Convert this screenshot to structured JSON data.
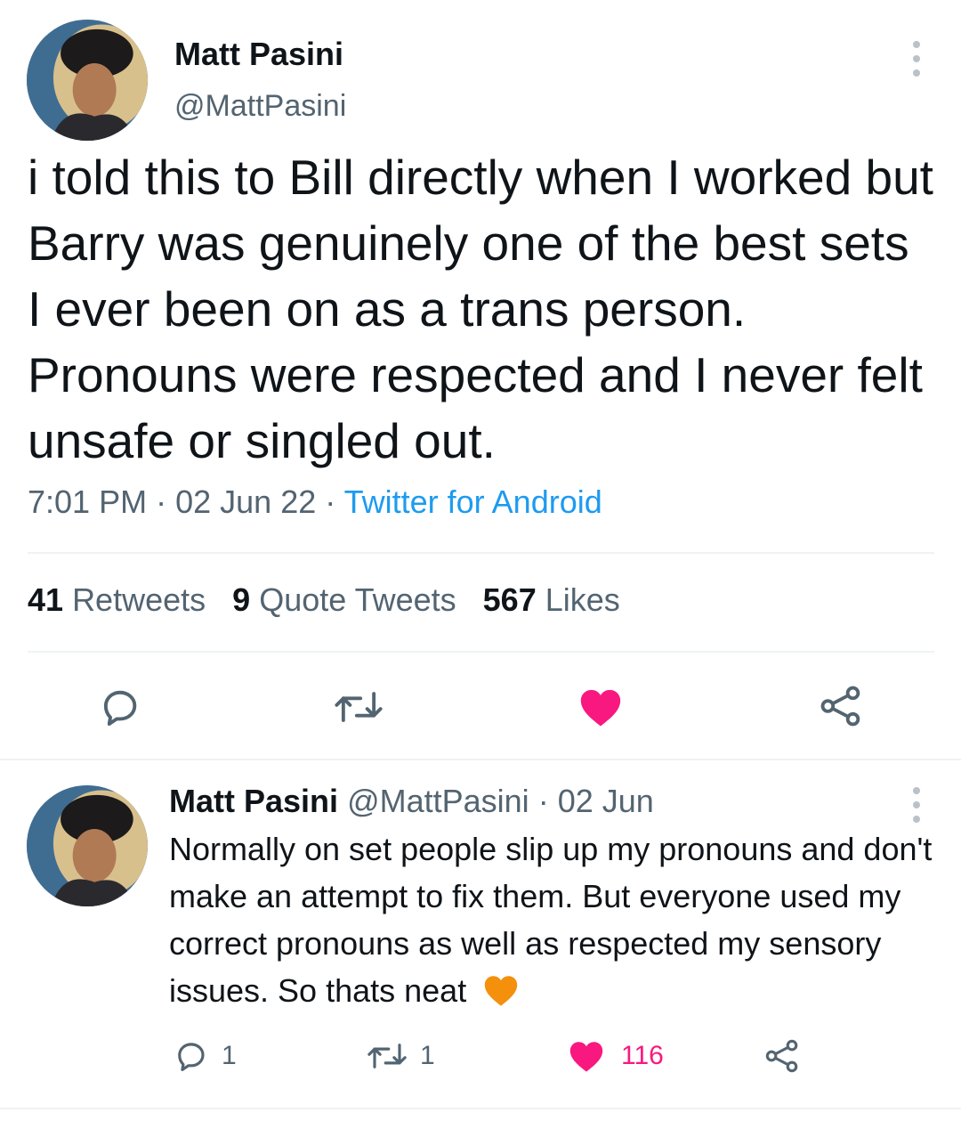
{
  "main_tweet": {
    "author_name": "Matt Pasini",
    "handle": "@MattPasini",
    "text": "i told this to Bill directly when I worked but Barry was genuinely one of the best sets I ever been on as a trans person. Pronouns were respected and I never felt unsafe or singled out.",
    "time": "7:01 PM",
    "separator": "·",
    "date": "02 Jun 22",
    "source": "Twitter for Android",
    "stats": {
      "retweets_count": "41",
      "retweets_label": "Retweets",
      "quotes_count": "9",
      "quotes_label": "Quote Tweets",
      "likes_count": "567",
      "likes_label": "Likes"
    },
    "liked": true
  },
  "reply_tweet": {
    "author_name": "Matt Pasini",
    "handle": "@MattPasini",
    "separator": "·",
    "date": "02 Jun",
    "text": "Normally on set people slip up my pronouns and don't make an attempt to fix them. But everyone used my correct pronouns as well as respected my sensory issues. So thats neat",
    "emoji": "orange-heart",
    "reply_count": "1",
    "retweet_count": "1",
    "like_count": "116",
    "liked": true
  },
  "colors": {
    "text_primary": "#0f1419",
    "text_secondary": "#536471",
    "link_blue": "#1d9bf0",
    "like_pink": "#f91880",
    "divider": "#eff3f4",
    "orange_heart": "#f4900c"
  },
  "icons": {
    "more": "more-vertical-icon",
    "reply": "reply-icon",
    "retweet": "retweet-icon",
    "like": "heart-filled-icon",
    "share": "share-icon"
  }
}
